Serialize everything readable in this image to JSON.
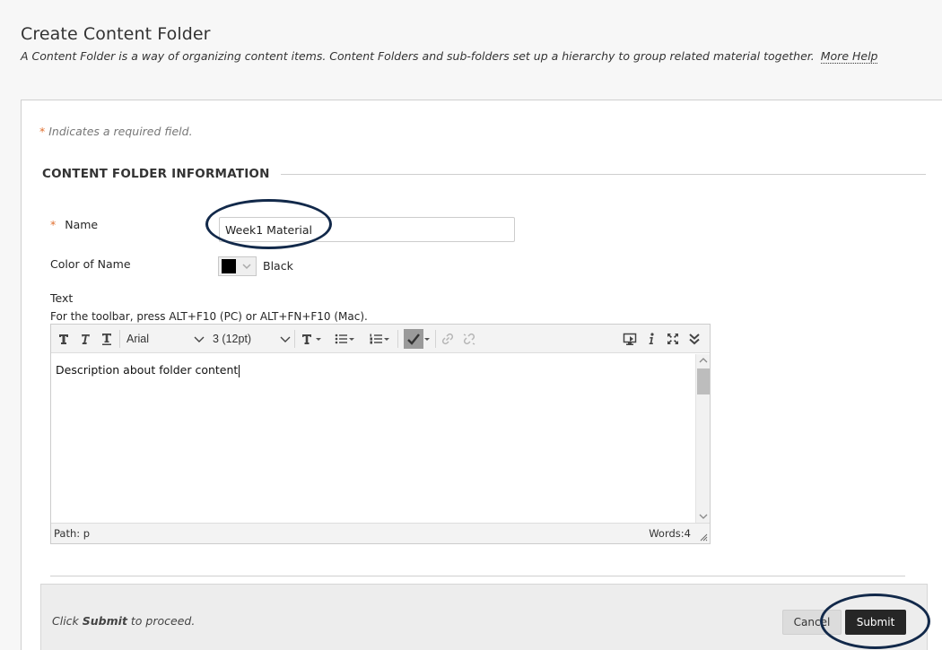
{
  "header": {
    "title": "Create Content Folder",
    "description": "A Content Folder is a way of organizing content items. Content Folders and sub-folders set up a hierarchy to group related material together.",
    "help_link": "More Help"
  },
  "form": {
    "required_star": "*",
    "required_note": "Indicates a required field.",
    "section_title": "CONTENT FOLDER INFORMATION",
    "name_label": "Name",
    "name_value": "Week1 Material",
    "color_label": "Color of Name",
    "color_value": "Black",
    "color_swatch": "#000000",
    "text_label": "Text",
    "toolbar_hint": "For the toolbar, press ALT+F10 (PC) or ALT+FN+F10 (Mac)."
  },
  "editor": {
    "font_family": "Arial",
    "font_size": "3 (12pt)",
    "content": "Description about folder content",
    "path_label": "Path:",
    "path_value": "p",
    "words_label": "Words:",
    "words_count": "4"
  },
  "submit_bar": {
    "note_prefix": "Click",
    "note_action": "Submit",
    "note_suffix": "to proceed.",
    "cancel_label": "Cancel",
    "submit_label": "Submit"
  },
  "colors": {
    "annotation_ring": "#12294a",
    "required_star": "#e07030",
    "submit_button": "#262626"
  }
}
